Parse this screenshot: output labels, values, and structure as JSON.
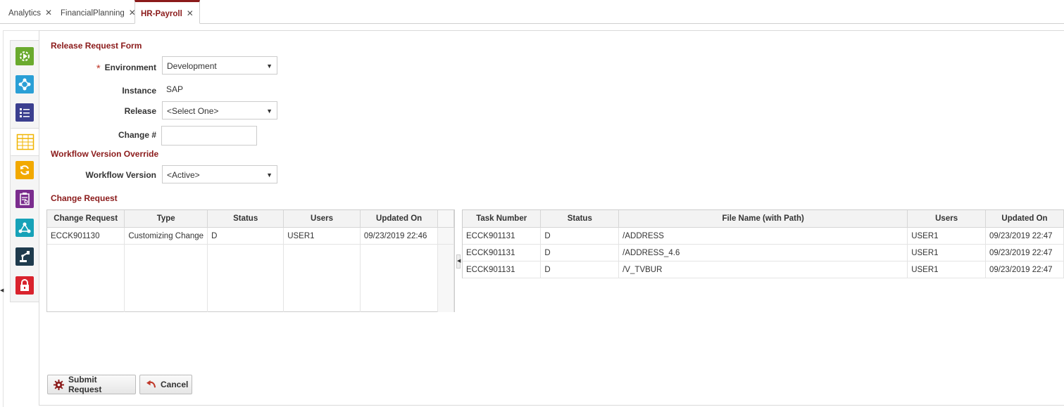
{
  "tabs": [
    {
      "label": "Analytics",
      "active": false
    },
    {
      "label": "FinancialPlanning",
      "active": false
    },
    {
      "label": "HR-Payroll",
      "active": true
    }
  ],
  "sidebar": {
    "icons": [
      "deploy-icon",
      "integration-icon",
      "checklist-icon",
      "table-grid-icon",
      "sync-icon",
      "report-icon",
      "network-icon",
      "robot-arm-icon",
      "lock-icon"
    ],
    "selected_index": 3
  },
  "form": {
    "title": "Release Request Form",
    "environment_label": "Environment",
    "environment_value": "Development",
    "instance_label": "Instance",
    "instance_value": "SAP",
    "release_label": "Release",
    "release_value": "<Select One>",
    "change_label": "Change #",
    "change_value": "",
    "workflow_section_title": "Workflow Version Override",
    "workflow_label": "Workflow Version",
    "workflow_value": "<Active>",
    "change_request_section_title": "Change Request"
  },
  "left_grid": {
    "columns": [
      "Change Request",
      "Type",
      "Status",
      "Users",
      "Updated On"
    ],
    "rows": [
      [
        "ECCK901130",
        "Customizing Change",
        "D",
        "USER1",
        "09/23/2019 22:46"
      ]
    ]
  },
  "right_grid": {
    "columns": [
      "Task Number",
      "Status",
      "File Name (with Path)",
      "Users",
      "Updated On"
    ],
    "rows": [
      [
        "ECCK901131",
        "D",
        "/ADDRESS",
        "USER1",
        "09/23/2019 22:47"
      ],
      [
        "ECCK901131",
        "D",
        "/ADDRESS_4.6",
        "USER1",
        "09/23/2019 22:47"
      ],
      [
        "ECCK901131",
        "D",
        "/V_TVBUR",
        "USER1",
        "09/23/2019 22:47"
      ]
    ]
  },
  "buttons": {
    "submit": "Submit Request",
    "cancel": "Cancel"
  },
  "colors": {
    "accent": "#8b1a1a",
    "required": "#c0392b"
  }
}
